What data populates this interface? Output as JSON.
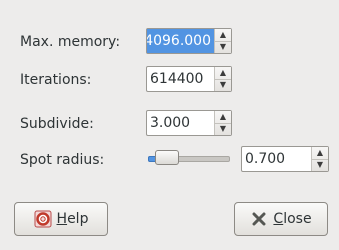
{
  "fields": {
    "max_memory": {
      "label": "Max. memory:",
      "value": "4096.000"
    },
    "iterations": {
      "label": "Iterations:",
      "value": "614400"
    },
    "subdivide": {
      "label": "Subdivide:",
      "value": "3.000"
    },
    "spot_radius": {
      "label": "Spot radius:",
      "value": "0.700",
      "slider_fraction": 0.12
    }
  },
  "buttons": {
    "help": {
      "mnemonic": "H",
      "rest": "elp",
      "icon": "lifebuoy-icon"
    },
    "close": {
      "mnemonic": "C",
      "rest": "lose",
      "icon": "close-x-icon"
    }
  },
  "spin_arrows": {
    "up": "▲",
    "down": "▼"
  }
}
